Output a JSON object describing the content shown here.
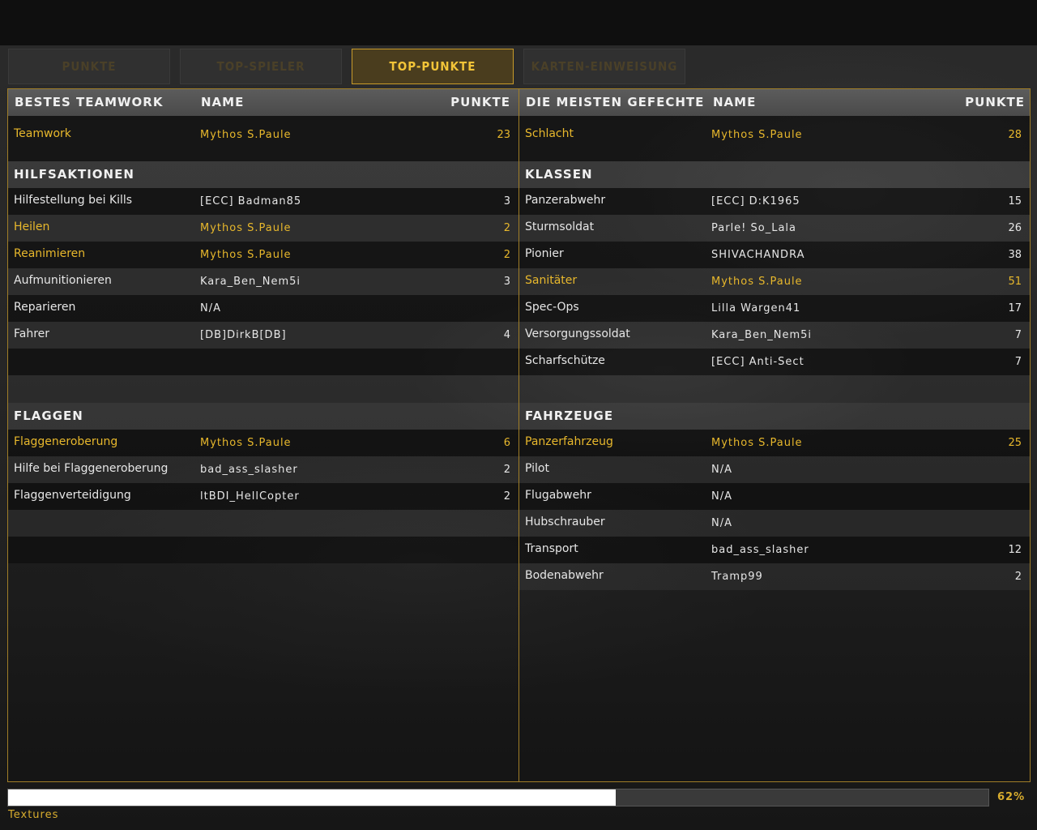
{
  "tabs": [
    {
      "label": "PUNKTE"
    },
    {
      "label": "TOP-SPIELER"
    },
    {
      "label": "TOP-PUNKTE"
    },
    {
      "label": "KARTEN-EINWEISUNG"
    }
  ],
  "colors": {
    "accent": "#e8b82c",
    "active_tab_bg": "#4a3d1e",
    "panel_border": "#a07e28"
  },
  "left": {
    "headers": {
      "category": "BESTES TEAMWORK",
      "name": "NAME",
      "points": "PUNKTE"
    },
    "top": {
      "label": "Teamwork",
      "name": "Mythos S.Paule",
      "points": "23"
    },
    "section1": "HILFSAKTIONEN",
    "rows1": [
      {
        "label": "Hilfestellung bei Kills",
        "name": "[ECC] Badman85",
        "points": "3"
      },
      {
        "label": "Heilen",
        "name": "Mythos S.Paule",
        "points": "2"
      },
      {
        "label": "Reanimieren",
        "name": "Mythos S.Paule",
        "points": "2"
      },
      {
        "label": "Aufmunitionieren",
        "name": "Kara_Ben_Nem5i",
        "points": "3"
      },
      {
        "label": "Reparieren",
        "name": "N/A",
        "points": ""
      },
      {
        "label": "Fahrer",
        "name": "[DB]DirkB[DB]",
        "points": "4"
      }
    ],
    "section2": "FLAGGEN",
    "rows2": [
      {
        "label": "Flaggeneroberung",
        "name": "Mythos S.Paule",
        "points": "6"
      },
      {
        "label": "Hilfe bei Flaggeneroberung",
        "name": "bad_ass_slasher",
        "points": "2"
      },
      {
        "label": "Flaggenverteidigung",
        "name": "ltBDI_HellCopter",
        "points": "2"
      }
    ]
  },
  "right": {
    "headers": {
      "category": "DIE MEISTEN GEFECHTE",
      "name": "NAME",
      "points": "PUNKTE"
    },
    "top": {
      "label": "Schlacht",
      "name": "Mythos S.Paule",
      "points": "28"
    },
    "section1": "KLASSEN",
    "rows1": [
      {
        "label": "Panzerabwehr",
        "name": "[ECC] D:K1965",
        "points": "15"
      },
      {
        "label": "Sturmsoldat",
        "name": "Parle! So_Lala",
        "points": "26"
      },
      {
        "label": "Pionier",
        "name": "SHIVACHANDRA",
        "points": "38"
      },
      {
        "label": "Sanitäter",
        "name": "Mythos S.Paule",
        "points": "51"
      },
      {
        "label": "Spec-Ops",
        "name": "Lilla Wargen41",
        "points": "17"
      },
      {
        "label": "Versorgungssoldat",
        "name": "Kara_Ben_Nem5i",
        "points": "7"
      },
      {
        "label": "Scharfschütze",
        "name": "[ECC] Anti-Sect",
        "points": "7"
      }
    ],
    "section2": "FAHRZEUGE",
    "rows2": [
      {
        "label": "Panzerfahrzeug",
        "name": "Mythos S.Paule",
        "points": "25"
      },
      {
        "label": "Pilot",
        "name": "N/A",
        "points": ""
      },
      {
        "label": "Flugabwehr",
        "name": "N/A",
        "points": ""
      },
      {
        "label": "Hubschrauber",
        "name": "N/A",
        "points": ""
      },
      {
        "label": "Transport",
        "name": "bad_ass_slasher",
        "points": "12"
      },
      {
        "label": "Bodenabwehr",
        "name": "Tramp99",
        "points": "2"
      }
    ]
  },
  "progress": {
    "percent_text": "62%",
    "value": 0.62,
    "label": "Textures"
  }
}
